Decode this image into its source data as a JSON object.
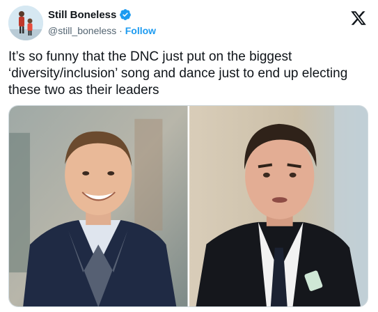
{
  "author": {
    "display_name": "Still Boneless",
    "handle": "@still_boneless",
    "separator": "·",
    "follow_label": "Follow",
    "verified_icon": "verified-badge-icon",
    "verified_color": "#1d9bf0"
  },
  "platform_icon": "x-logo-icon",
  "tweet": {
    "text": "It’s so funny that the DNC just put on the biggest ‘diversity/inclusion’ song and dance just to end up electing these two as their leaders"
  },
  "media": {
    "count": 2
  },
  "colors": {
    "link": "#1d9bf0",
    "text": "#0f1419",
    "muted": "#536471"
  }
}
